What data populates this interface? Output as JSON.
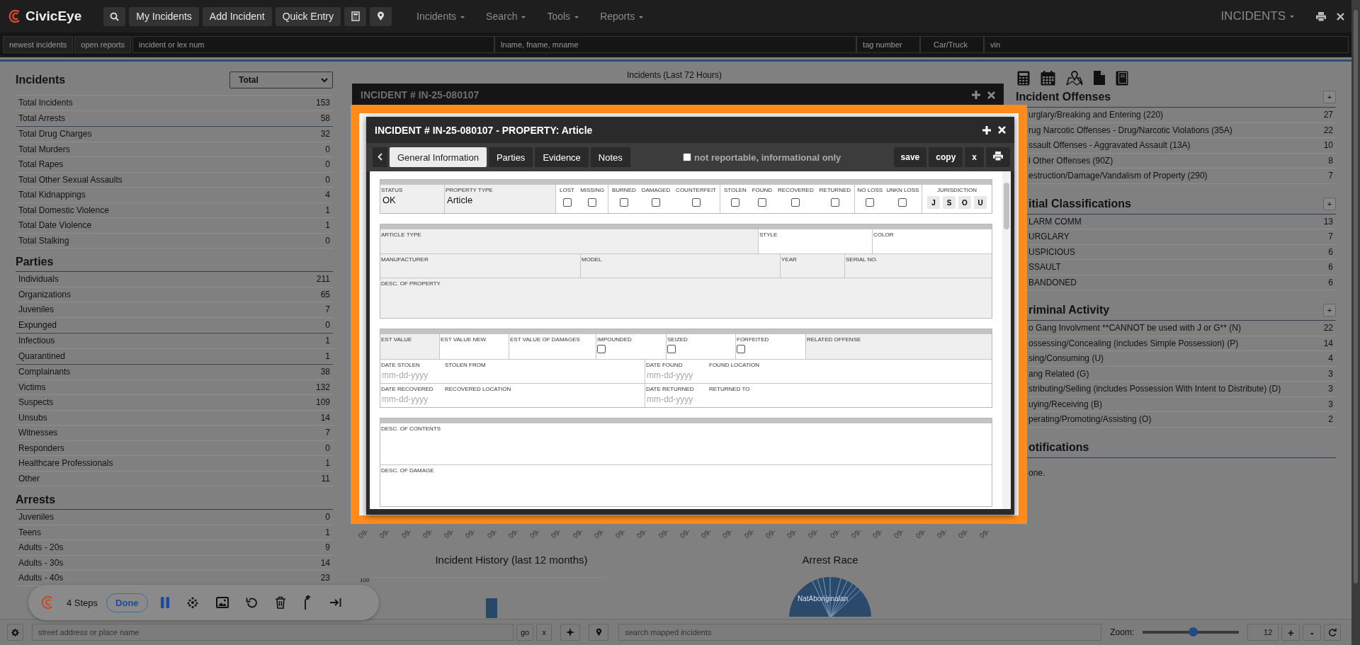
{
  "navbar": {
    "logo": "CivicEye",
    "buttons": [
      "My Incidents",
      "Add Incident",
      "Quick Entry"
    ],
    "menus": [
      "Incidents",
      "Search",
      "Tools",
      "Reports"
    ],
    "module": "INCIDENTS"
  },
  "search_bar": {
    "buttons": [
      "newest incidents",
      "open reports"
    ],
    "fields": [
      {
        "kind": "input",
        "placeholder": "incident or lex num"
      },
      {
        "kind": "input",
        "placeholder": "lname, fname, mname"
      },
      {
        "kind": "input",
        "placeholder": "tag number"
      },
      {
        "kind": "select",
        "value": "Car/Truck"
      },
      {
        "kind": "input",
        "placeholder": "vin"
      }
    ]
  },
  "left_panel": {
    "sections": [
      {
        "title": "Incidents",
        "filter": "Total",
        "groups": [
          [
            {
              "label": "Total Incidents",
              "count": "153"
            },
            {
              "label": "Total Arrests",
              "count": "58"
            }
          ],
          [
            {
              "label": "Total Drug Charges",
              "count": "32"
            },
            {
              "label": "Total Murders",
              "count": "0"
            },
            {
              "label": "Total Rapes",
              "count": "0"
            },
            {
              "label": "Total Other Sexual Assaults",
              "count": "0"
            },
            {
              "label": "Total Kidnappings",
              "count": "4"
            },
            {
              "label": "Total Domestic Violence",
              "count": "1"
            },
            {
              "label": "Total Date Violence",
              "count": "1"
            },
            {
              "label": "Total Stalking",
              "count": "0"
            }
          ]
        ]
      },
      {
        "title": "Parties",
        "groups": [
          [
            {
              "label": "Individuals",
              "count": "211"
            },
            {
              "label": "Organizations",
              "count": "65"
            },
            {
              "label": "Juveniles",
              "count": "7"
            },
            {
              "label": "Expunged",
              "count": "0"
            }
          ],
          [
            {
              "label": "Infectious",
              "count": "1"
            },
            {
              "label": "Quarantined",
              "count": "1"
            }
          ],
          [
            {
              "label": "Complainants",
              "count": "38"
            },
            {
              "label": "Victims",
              "count": "132"
            },
            {
              "label": "Suspects",
              "count": "109"
            },
            {
              "label": "Unsubs",
              "count": "14"
            },
            {
              "label": "Witnesses",
              "count": "7"
            },
            {
              "label": "Responders",
              "count": "0"
            },
            {
              "label": "Healthcare Professionals",
              "count": "1"
            },
            {
              "label": "Other",
              "count": "11"
            }
          ]
        ]
      },
      {
        "title": "Arrests",
        "groups": [
          [
            {
              "label": "Juveniles",
              "count": "0"
            },
            {
              "label": "Teens",
              "count": "1"
            },
            {
              "label": "Adults - 20s",
              "count": "9"
            },
            {
              "label": "Adults - 30s",
              "count": "14"
            },
            {
              "label": "Adults - 40s",
              "count": "23"
            }
          ]
        ]
      }
    ]
  },
  "center": {
    "chart_title": "Incidents (Last 72 Hours)",
    "tick_labels": [
      "09-",
      "09-",
      "09-",
      "09-",
      "09-",
      "09-",
      "09-",
      "09-",
      "09-",
      "09-",
      "09-",
      "09-",
      "09-",
      "09-",
      "09-",
      "09-",
      "09-",
      "09-",
      "09-",
      "09-",
      "09-",
      "09-",
      "09-",
      "09-",
      "09-",
      "09-",
      "09-",
      "09-",
      "09-",
      "09-"
    ],
    "history_title": "Incident History (last 12 months)",
    "history_tick": "100",
    "race_title": "Arrest Race",
    "race_label": "NatAboriginalan"
  },
  "right_panel": {
    "sections": [
      {
        "title": "Incident Offenses",
        "add": "+",
        "items": [
          {
            "label": "urglary/Breaking and Entering (220)",
            "count": "27"
          },
          {
            "label": "rug Narcotic Offenses - Drug/Narcotic Violations (35A)",
            "count": "22"
          },
          {
            "label": "ssault Offenses - Aggravated Assault (13A)",
            "count": "10"
          },
          {
            "label": "l Other Offenses (90Z)",
            "count": "8"
          },
          {
            "label": "estruction/Damage/Vandalism of Property (290)",
            "count": "7"
          }
        ]
      },
      {
        "title": "itial Classifications",
        "add": "+",
        "items": [
          {
            "label": "LARM COMM",
            "count": "13"
          },
          {
            "label": "URGLARY",
            "count": "7"
          },
          {
            "label": "USPICIOUS",
            "count": "6"
          },
          {
            "label": "SSAULT",
            "count": "6"
          },
          {
            "label": "BANDONED",
            "count": "6"
          }
        ]
      },
      {
        "title": "riminal Activity",
        "add": "+",
        "items": [
          {
            "label": "o Gang Involvment **CANNOT be used with J or G** (N)",
            "count": "22"
          },
          {
            "label": "ossessing/Concealing (includes Simple Possession) (P)",
            "count": "14"
          },
          {
            "label": "sing/Consuming (U)",
            "count": "4"
          },
          {
            "label": "ang Related (G)",
            "count": "3"
          },
          {
            "label": "stributing/Selling (includes Possession With Intent to Distribute) (D)",
            "count": "3"
          },
          {
            "label": "uying/Receiving (B)",
            "count": "3"
          },
          {
            "label": "perating/Promoting/Assisting (O)",
            "count": "2"
          }
        ]
      },
      {
        "title": "otifications",
        "text": "one."
      }
    ]
  },
  "back_modal": {
    "title": "INCIDENT # IN-25-080107"
  },
  "modal": {
    "title": "INCIDENT # IN-25-080107 - PROPERTY: Article",
    "tabs": [
      {
        "label": "General Information",
        "selected": true
      },
      {
        "label": "Parties",
        "selected": false
      },
      {
        "label": "Evidence",
        "selected": false
      },
      {
        "label": "Notes",
        "selected": false
      }
    ],
    "not_reportable": {
      "label": "not reportable, informational only",
      "checked": false
    },
    "actions": [
      "save",
      "copy",
      "x"
    ],
    "sections": [
      {
        "rows": [
          [
            {
              "kind": "text",
              "label": "STATUS",
              "value": "OK",
              "shaded": true
            },
            {
              "kind": "text",
              "label": "PROPERTY TYPE",
              "value": "Article",
              "shaded": true
            },
            {
              "kind": "checks",
              "items": [
                {
                  "label": "LOST",
                  "checked": false
                },
                {
                  "label": "MISSING",
                  "checked": false
                }
              ]
            },
            {
              "kind": "checks",
              "items": [
                {
                  "label": "BURNED",
                  "checked": false
                },
                {
                  "label": "DAMAGED",
                  "checked": false
                },
                {
                  "label": "COUNTERFEIT",
                  "checked": false
                }
              ]
            },
            {
              "kind": "checks",
              "items": [
                {
                  "label": "STOLEN",
                  "checked": false
                },
                {
                  "label": "FOUND",
                  "checked": false
                },
                {
                  "label": "RECOVERED",
                  "checked": false
                },
                {
                  "label": "RETURNED",
                  "checked": false
                }
              ]
            },
            {
              "kind": "checks",
              "items": [
                {
                  "label": "NO LOSS",
                  "checked": false
                },
                {
                  "label": "UNKN LOSS",
                  "checked": false
                }
              ]
            },
            {
              "kind": "buttons",
              "label": "JURISDICTION",
              "buttons": [
                "J",
                "S",
                "O",
                "U"
              ]
            }
          ]
        ]
      },
      {
        "rows": [
          [
            {
              "kind": "text",
              "label": "ARTICLE TYPE",
              "shaded": true
            },
            {
              "kind": "text",
              "label": "STYLE",
              "shaded": false
            },
            {
              "kind": "text",
              "label": "COLOR",
              "shaded": false
            }
          ],
          [
            {
              "kind": "text",
              "label": "MANUFACTURER",
              "shaded": true
            },
            {
              "kind": "text",
              "label": "MODEL",
              "shaded": true
            },
            {
              "kind": "text",
              "label": "YEAR",
              "shaded": true
            },
            {
              "kind": "text",
              "label": "SERIAL NO.",
              "shaded": true
            }
          ],
          [
            {
              "kind": "text",
              "label": "DESC. OF PROPERTY",
              "shaded": true
            }
          ]
        ]
      },
      {
        "rows": [
          [
            {
              "kind": "text",
              "label": "EST VALUE",
              "shaded": true
            },
            {
              "kind": "text",
              "label": "EST VALUE NEW",
              "shaded": false
            },
            {
              "kind": "text",
              "label": "EST VALUE OF DAMAGES",
              "shaded": false
            },
            {
              "kind": "check",
              "label": "IMPOUNDED",
              "checked": false,
              "shaded": false
            },
            {
              "kind": "check",
              "label": "SEIZED",
              "checked": false,
              "shaded": false
            },
            {
              "kind": "check",
              "label": "FORFEITED",
              "checked": false,
              "shaded": false
            },
            {
              "kind": "text",
              "label": "RELATED OFFENSE",
              "shaded": true
            }
          ],
          [
            {
              "kind": "date",
              "label": "DATE STOLEN",
              "placeholder": "mm-dd-yyyy",
              "shaded": false
            },
            {
              "kind": "text",
              "label": "STOLEN FROM",
              "shaded": false
            },
            {
              "kind": "date",
              "label": "DATE FOUND",
              "placeholder": "mm-dd-yyyy",
              "shaded": false
            },
            {
              "kind": "text",
              "label": "FOUND LOCATION",
              "shaded": false
            }
          ],
          [
            {
              "kind": "date",
              "label": "DATE RECOVERED",
              "placeholder": "mm-dd-yyyy",
              "shaded": false
            },
            {
              "kind": "text",
              "label": "RECOVERED LOCATION",
              "shaded": false
            },
            {
              "kind": "date",
              "label": "DATE RETURNED",
              "placeholder": "mm-dd-yyyy",
              "shaded": false
            },
            {
              "kind": "text",
              "label": "RETURNED TO",
              "shaded": false
            }
          ]
        ]
      },
      {
        "rows": [
          [
            {
              "kind": "text",
              "label": "DESC. OF CONTENTS",
              "shaded": false
            }
          ],
          [
            {
              "kind": "text",
              "label": "DESC. OF DAMAGE",
              "shaded": false
            }
          ]
        ]
      }
    ]
  },
  "recorder": {
    "steps": "4 Steps",
    "done": "Done"
  },
  "bottom_bar": {
    "address": {
      "placeholder": "street address or place name"
    },
    "go": "go",
    "clear": "x",
    "map_search": {
      "placeholder": "search mapped incidents"
    },
    "zoom_label": "Zoom:",
    "zoom": {
      "level": 0.52
    },
    "zoom_value": "12",
    "zoom_in": "+",
    "zoom_out": "-"
  }
}
